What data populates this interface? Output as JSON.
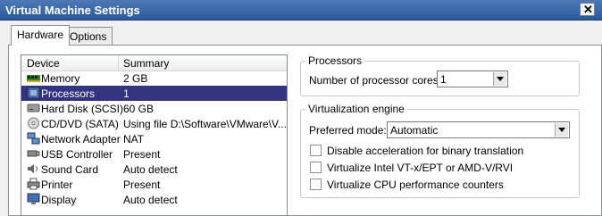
{
  "window": {
    "title": "Virtual Machine Settings",
    "close_glyph": "✕"
  },
  "tabs": [
    {
      "label": "Hardware",
      "active": true
    },
    {
      "label": "Options",
      "active": false
    }
  ],
  "device_list": {
    "columns": {
      "device": "Device",
      "summary": "Summary"
    },
    "rows": [
      {
        "icon": "memory-icon",
        "device": "Memory",
        "summary": "2 GB"
      },
      {
        "icon": "processor-icon",
        "device": "Processors",
        "summary": "1",
        "selected": true
      },
      {
        "icon": "hard-disk-icon",
        "device": "Hard Disk (SCSI)",
        "summary": "60 GB"
      },
      {
        "icon": "cd-dvd-icon",
        "device": "CD/DVD (SATA)",
        "summary": "Using file D:\\Software\\VMware\\V..."
      },
      {
        "icon": "network-adapter-icon",
        "device": "Network Adapter",
        "summary": "NAT"
      },
      {
        "icon": "usb-icon",
        "device": "USB Controller",
        "summary": "Present"
      },
      {
        "icon": "sound-icon",
        "device": "Sound Card",
        "summary": "Auto detect"
      },
      {
        "icon": "printer-icon",
        "device": "Printer",
        "summary": "Present"
      },
      {
        "icon": "display-icon",
        "device": "Display",
        "summary": "Auto detect"
      }
    ]
  },
  "processors": {
    "group_title": "Processors",
    "cores_label": "Number of processor cores:",
    "cores_value": "1"
  },
  "virtualization": {
    "group_title": "Virtualization engine",
    "mode_label": "Preferred mode:",
    "mode_value": "Automatic",
    "options": [
      {
        "label": "Disable acceleration for binary translation",
        "checked": false
      },
      {
        "label": "Virtualize Intel VT-x/EPT or AMD-V/RVI",
        "checked": false
      },
      {
        "label": "Virtualize CPU performance counters",
        "checked": false
      }
    ]
  },
  "colors": {
    "title_bar": "#2a5a9c",
    "selection": "#33337f"
  }
}
